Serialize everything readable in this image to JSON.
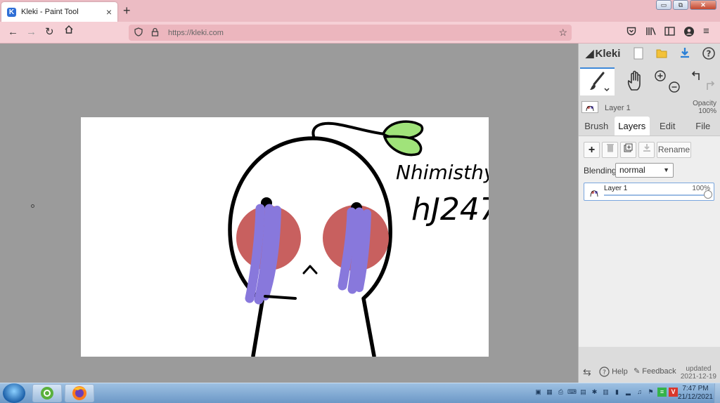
{
  "browser": {
    "tab_title": "Kleki - Paint Tool",
    "tab_close": "×",
    "new_tab": "+",
    "url": "https://kleki.com",
    "window_controls": [
      "▭",
      "⧉",
      "✕"
    ]
  },
  "kleki": {
    "brand": "Kleki",
    "layer_name": "Layer 1",
    "opacity_label": "Opacity",
    "opacity_value": "100%",
    "tabs": [
      "Brush",
      "Layers",
      "Edit",
      "File"
    ],
    "active_tab": "Layers",
    "rename_label": "Rename",
    "blending_label": "Blending",
    "blending_value": "normal",
    "layer_item": {
      "name": "Layer 1",
      "opacity": "100%",
      "opacity_fraction": 1.0
    },
    "footer": {
      "help": "Help",
      "feedback": "Feedback",
      "updated_label": "updated",
      "updated_date": "2021-12-19"
    }
  },
  "drawing": {
    "handwriting_line1": "Nhimisthy",
    "handwriting_line2": "hJ247"
  },
  "taskbar": {
    "time": "7:47 PM",
    "date": "21/12/2021"
  },
  "colors": {
    "tab_strip": "#ecbcc4",
    "toolbar": "#f6d0d6",
    "leaf": "#a0e37a",
    "cheek": "#c8605f",
    "tears": "#8878dc"
  }
}
